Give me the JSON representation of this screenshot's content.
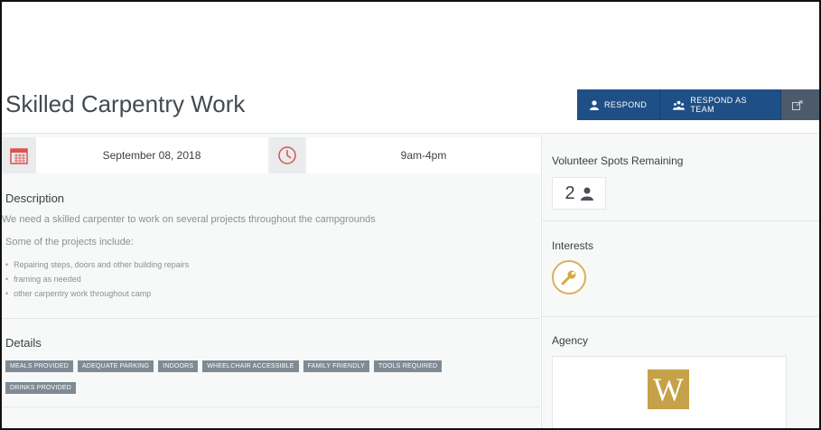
{
  "page": {
    "title": "Skilled Carpentry Work"
  },
  "actions": {
    "respond": "RESPOND",
    "respond_team": "RESPOND AS TEAM"
  },
  "when": {
    "date": "September 08, 2018",
    "time": "9am-4pm"
  },
  "description": {
    "heading": "Description",
    "summary": "We need a skilled carpenter to work on several projects throughout the campgrounds",
    "intro": "Some of the projects include:",
    "items": [
      "Repairing steps, doors and other building repairs",
      "framing as needed",
      "other carpentry work throughout camp"
    ]
  },
  "details": {
    "heading": "Details",
    "tags": [
      "MEALS PROVIDED",
      "ADEQUATE PARKING",
      "INDOORS",
      "WHEELCHAIR ACCESSIBLE",
      "FAMILY FRIENDLY",
      "TOOLS REQUIRED",
      "DRINKS PROVIDED"
    ]
  },
  "sidebar": {
    "spots_heading": "Volunteer Spots Remaining",
    "spots_value": "2",
    "interests_heading": "Interests",
    "interest_icon": "wrench-icon",
    "agency_heading": "Agency",
    "agency_logo_letter": "W"
  },
  "colors": {
    "primary_button": "#1e4f86",
    "share_button": "#4c5a6b",
    "tag": "#7f8a94",
    "accent_gold": "#c5a24a",
    "calendar_red": "#d9534f"
  }
}
